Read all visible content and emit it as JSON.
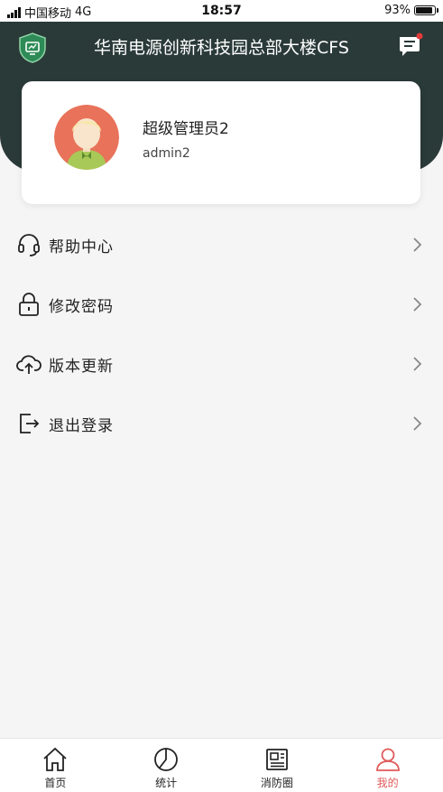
{
  "status_bar": {
    "carrier": "中国移动",
    "network": "4G",
    "time": "18:57",
    "battery": "93%"
  },
  "header": {
    "title": "华南电源创新科技园总部大楼CFS",
    "logo_icon": "shield-screen-icon",
    "message_icon": "message-icon"
  },
  "profile": {
    "name": "超级管理员2",
    "account": "admin2"
  },
  "menu": {
    "items": [
      {
        "label": "帮助中心",
        "icon": "headset-icon"
      },
      {
        "label": "修改密码",
        "icon": "lock-icon"
      },
      {
        "label": "版本更新",
        "icon": "cloud-upload-icon"
      },
      {
        "label": "退出登录",
        "icon": "logout-icon"
      }
    ]
  },
  "tabbar": {
    "tabs": [
      {
        "label": "首页",
        "icon": "home-icon"
      },
      {
        "label": "统计",
        "icon": "pie-chart-icon"
      },
      {
        "label": "消防圈",
        "icon": "newspaper-icon"
      },
      {
        "label": "我的",
        "icon": "user-icon"
      }
    ],
    "active": "我的"
  },
  "colors": {
    "header_bg": "#2a3a38",
    "accent": "#e05a5a",
    "badge": "#e33b3b",
    "logo_green": "#2e8b57"
  }
}
